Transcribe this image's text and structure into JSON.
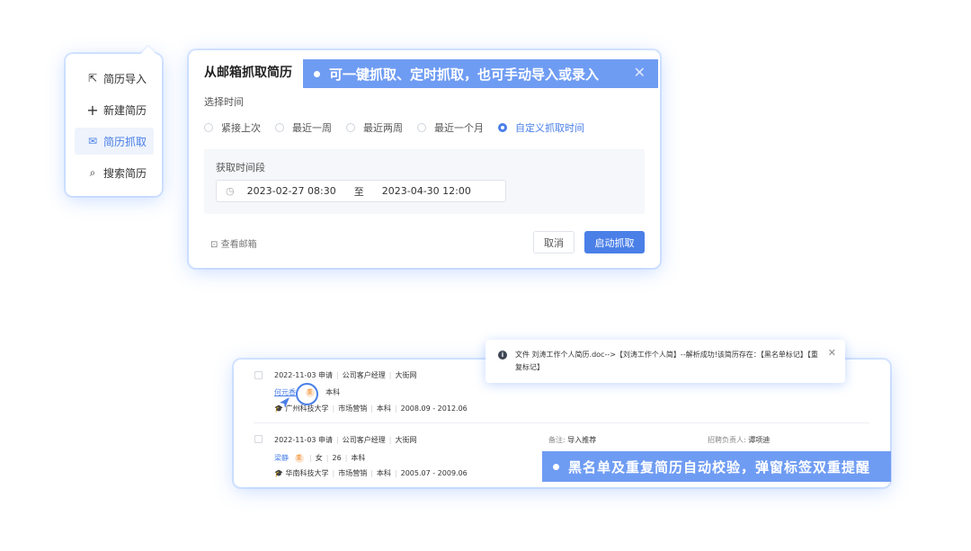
{
  "side_menu": {
    "items": [
      {
        "icon": "export-icon",
        "glyph": "⇱",
        "label": "简历导入"
      },
      {
        "icon": "plus-icon",
        "glyph": "+",
        "label": "新建简历"
      },
      {
        "icon": "mail-icon",
        "glyph": "✉",
        "label": "简历抓取"
      },
      {
        "icon": "search-icon",
        "glyph": "⌕",
        "label": "搜索简历"
      }
    ]
  },
  "dialog": {
    "title": "从邮箱抓取简历",
    "select_time_label": "选择时间",
    "options": [
      "紧接上次",
      "最近一周",
      "最近两周",
      "最近一个月",
      "自定义抓取时间"
    ],
    "period_label": "获取时间段",
    "start": "2023-02-27 08:30",
    "separator": "至",
    "end": "2023-04-30 12:00",
    "view_mailbox": "查看邮箱",
    "cancel": "取消",
    "start_button": "启动抓取"
  },
  "banner_top": {
    "text": "可一键抓取、定时抓取，也可手动导入或录入",
    "close": "✕"
  },
  "notification": {
    "text": "文件 刘涛工作个人简历.doc-->【刘涛工作个人简】--解析成功!该简历存在：【黑名单标记】【重复标记】",
    "close": "✕"
  },
  "candidates": [
    {
      "date": "2022-11-03 申请",
      "position": "公司客户经理",
      "source": "大街网",
      "name": "何元香",
      "tag": "重",
      "extra": "本科",
      "school": "广州科技大学",
      "major": "市场营销",
      "degree": "本科",
      "period": "2008.09 - 2012.06"
    },
    {
      "date": "2022-11-03 申请",
      "position": "公司客户经理",
      "source": "大街网",
      "name": "梁静",
      "tag": "重",
      "gender": "女",
      "age": "26",
      "extra": "本科",
      "school": "华南科技大学",
      "major": "市场营销",
      "degree": "本科",
      "period": "2005.07 - 2009.06",
      "note_label": "备注:",
      "note": "导入推荐",
      "recruiter_label": "招聘负责人:",
      "recruiter": "谭项迪"
    }
  ],
  "banner_bottom": {
    "text": "黑名单及重复简历自动校验，弹窗标签双重提醒"
  },
  "colors": {
    "accent": "#4a7fe8",
    "banner": "#6f9cf3",
    "tag_bg": "#fde6d2",
    "tag_fg": "#f08a24"
  }
}
